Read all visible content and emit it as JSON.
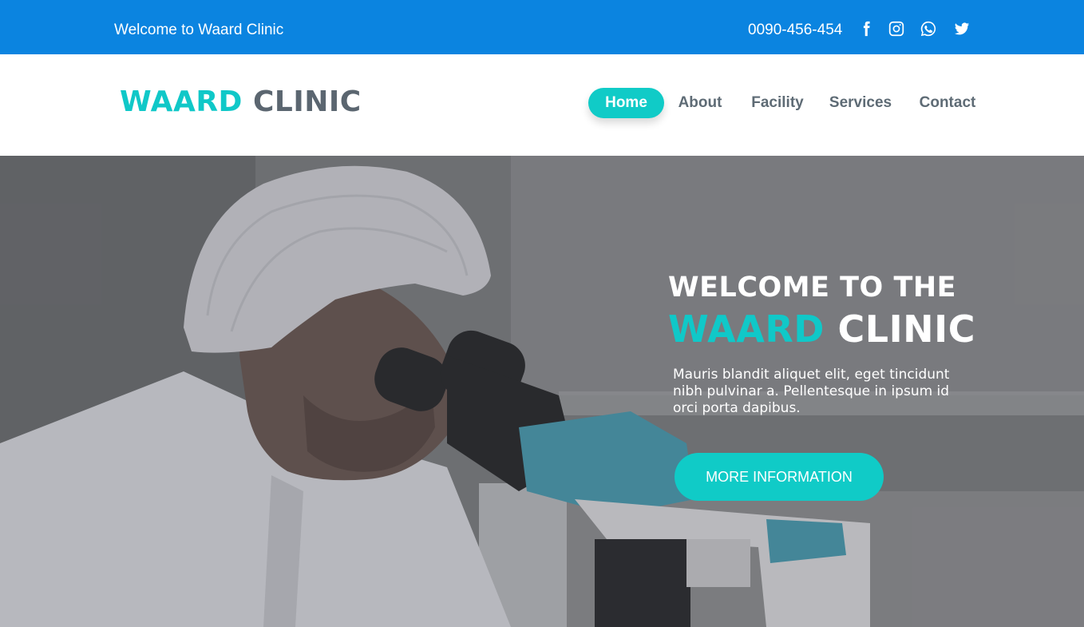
{
  "topbar": {
    "welcome": "Welcome to Waard Clinic",
    "phone": "0090-456-454",
    "social": [
      "facebook-icon",
      "instagram-icon",
      "whatsapp-icon",
      "twitter-icon"
    ],
    "background": "#0b84e0"
  },
  "header": {
    "logo_accent": "WAARD",
    "logo_rest": "CLINIC",
    "nav": [
      {
        "label": "Home",
        "active": true
      },
      {
        "label": "About",
        "active": false
      },
      {
        "label": "Facility",
        "active": false
      },
      {
        "label": "Services",
        "active": false
      },
      {
        "label": "Contact",
        "active": false
      }
    ]
  },
  "hero": {
    "title_line1": "WELCOME TO THE",
    "title_accent": "WAARD",
    "title_rest": "CLINIC",
    "description": "Mauris blandit aliquet elit, eget tincidunt nibh pulvinar a. Pellentesque in ipsum id orci porta dapibus.",
    "cta_label": "MORE INFORMATION"
  },
  "colors": {
    "accent": "#10cbc7",
    "brand_blue": "#0b84e0",
    "text_gray": "#5e6b75"
  }
}
